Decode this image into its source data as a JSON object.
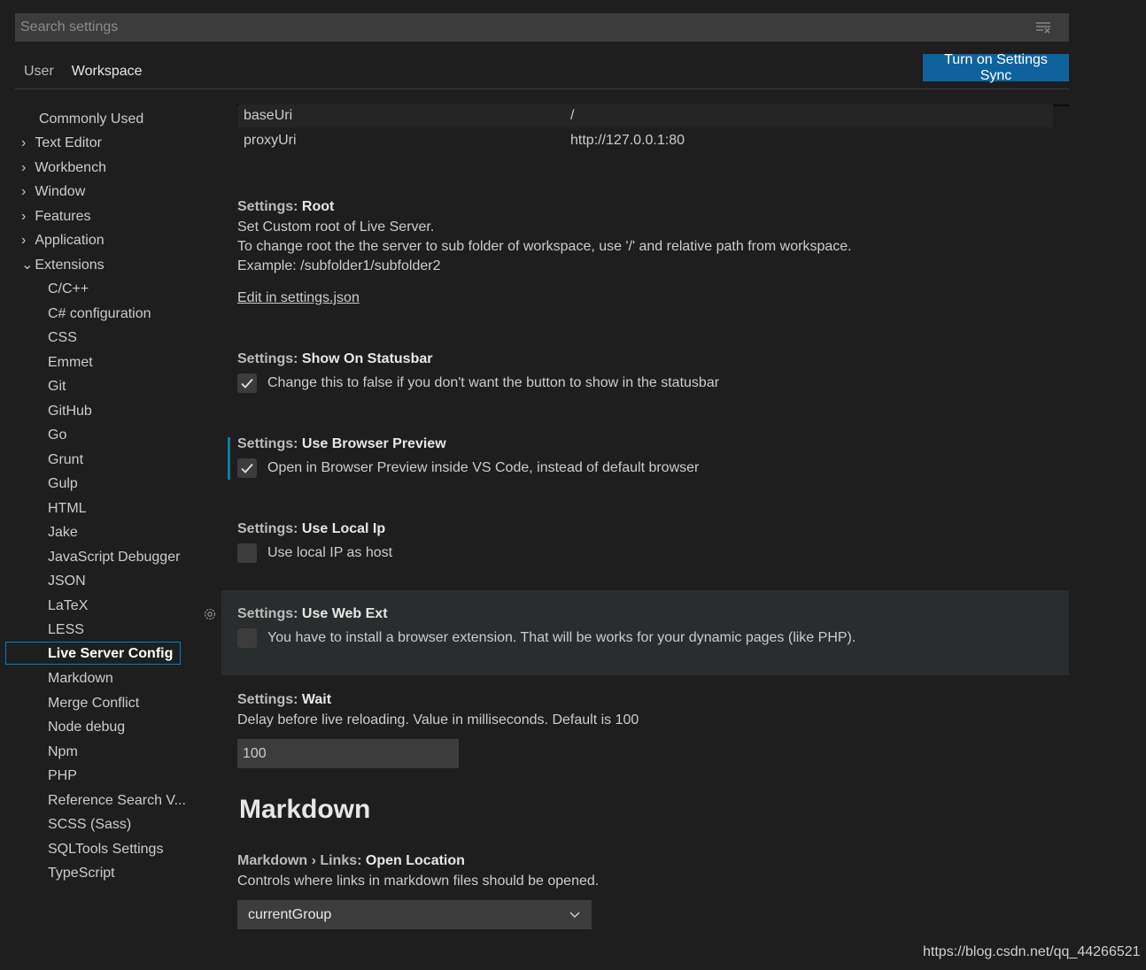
{
  "search": {
    "placeholder": "Search settings",
    "clear_icon": "clear-filter-icon"
  },
  "tabs": [
    {
      "label": "User"
    },
    {
      "label": "Workspace"
    }
  ],
  "sync_button": "Turn on Settings Sync",
  "toc": {
    "top": [
      "Commonly Used",
      "Text Editor",
      "Workbench",
      "Window",
      "Features",
      "Application",
      "Extensions"
    ],
    "extensions": [
      "C/C++",
      "C# configuration",
      "CSS",
      "Emmet",
      "Git",
      "GitHub",
      "Go",
      "Grunt",
      "Gulp",
      "HTML",
      "Jake",
      "JavaScript Debugger",
      "JSON",
      "LaTeX",
      "LESS",
      "Live Server Config",
      "Markdown",
      "Merge Conflict",
      "Node debug",
      "Npm",
      "PHP",
      "Reference Search V...",
      "SCSS (Sass)",
      "SQLTools Settings",
      "TypeScript"
    ],
    "selected": "Live Server Config"
  },
  "object_table": [
    {
      "key": "baseUri",
      "value": "/"
    },
    {
      "key": "proxyUri",
      "value": "http://127.0.0.1:80"
    }
  ],
  "settings": {
    "root": {
      "category": "Settings: ",
      "name": "Root",
      "desc1": "Set Custom root of Live Server.",
      "desc2": "To change root the the server to sub folder of workspace, use '/' and relative path from workspace.",
      "desc3": "Example: /subfolder1/subfolder2",
      "link": "Edit in settings.json"
    },
    "show_on_statusbar": {
      "category": "Settings: ",
      "name": "Show On Statusbar",
      "desc": "Change this to false if you don't want the button to show in the statusbar",
      "checked": true
    },
    "use_browser_preview": {
      "category": "Settings: ",
      "name": "Use Browser Preview",
      "desc": "Open in Browser Preview inside VS Code, instead of default browser",
      "checked": true
    },
    "use_local_ip": {
      "category": "Settings: ",
      "name": "Use Local Ip",
      "desc": "Use local IP as host",
      "checked": false
    },
    "use_web_ext": {
      "category": "Settings: ",
      "name": "Use Web Ext",
      "desc": "You have to install a browser extension. That will be works for your dynamic pages (like PHP).",
      "checked": false
    },
    "wait": {
      "category": "Settings: ",
      "name": "Wait",
      "desc": "Delay before live reloading. Value in milliseconds. Default is 100",
      "value": "100"
    }
  },
  "markdown_section": {
    "title": "Markdown",
    "open_location": {
      "category": "Markdown › Links: ",
      "name": "Open Location",
      "desc": "Controls where links in markdown files should be opened.",
      "value": "currentGroup"
    }
  },
  "watermark": "https://blog.csdn.net/qq_44266521",
  "colors": {
    "accent": "#0e639c",
    "focus": "#007fd4",
    "modified": "#0c7d9d"
  }
}
